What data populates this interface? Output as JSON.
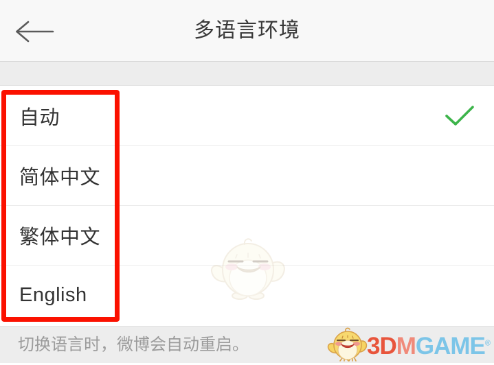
{
  "header": {
    "title": "多语言环境",
    "back_icon": "arrow-left-icon"
  },
  "list": {
    "items": [
      {
        "label": "自动",
        "selected": true
      },
      {
        "label": "简体中文",
        "selected": false
      },
      {
        "label": "繁体中文",
        "selected": false
      },
      {
        "label": "English",
        "selected": false
      }
    ],
    "check_icon": "check-icon",
    "check_color": "#3cb44a"
  },
  "footer": {
    "note": "切换语言时，微博会自动重启。"
  },
  "watermark": {
    "part1": "3D",
    "part2": "M",
    "part3": "GAME",
    "tm": "®",
    "bird_icon": "bird-mascot-icon"
  },
  "annotation": {
    "color": "#fb1100",
    "target": "language-options-list"
  },
  "decoration": {
    "center_bird_icon": "bird-mascot-watermark-icon"
  }
}
